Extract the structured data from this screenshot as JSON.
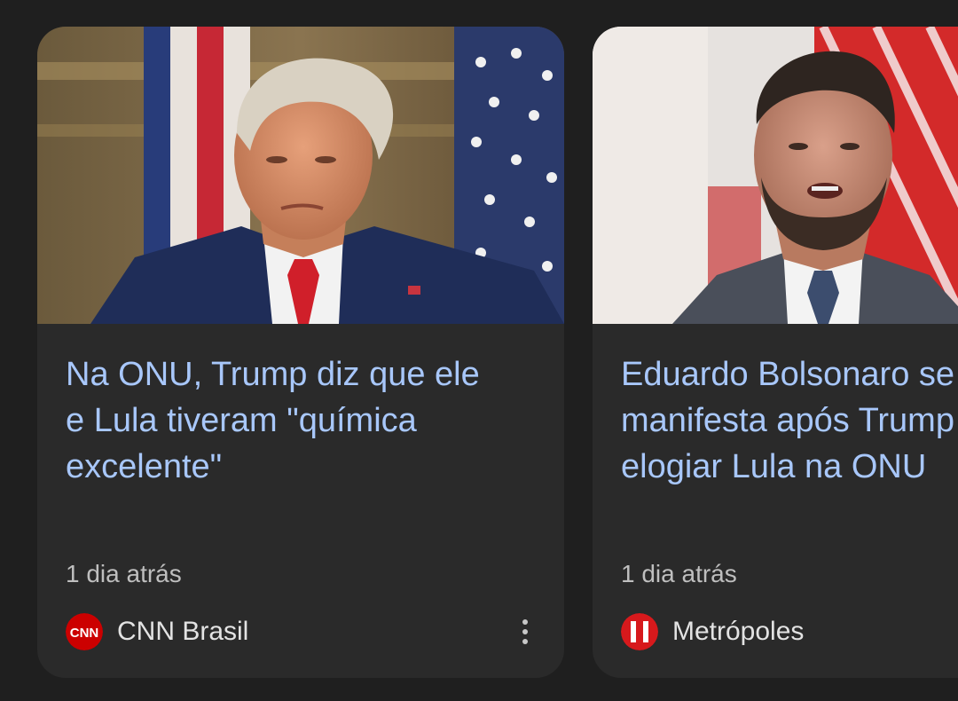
{
  "cards": [
    {
      "headline": "Na ONU, Trump diz que ele\ne Lula tiveram \"química\nexcelente\"",
      "time": "1 dia atrás",
      "source": "CNN Brasil",
      "logo_icon": "cnn-logo-icon",
      "image_subject": "trump-photo"
    },
    {
      "headline": "Eduardo Bolsonaro se\nmanifesta após Trump\nelogiar Lula na ONU",
      "time": "1 dia atrás",
      "source": "Metrópoles",
      "logo_icon": "metropoles-logo-icon",
      "image_subject": "eduardo-bolsonaro-photo"
    }
  ],
  "colors": {
    "background": "#1f1f1f",
    "card": "#2a2a2a",
    "headline": "#a8c7fa",
    "meta": "#bfbfbf",
    "source": "#e3e3e3",
    "cnn_red": "#cc0000",
    "metropoles_red": "#d7191c"
  }
}
